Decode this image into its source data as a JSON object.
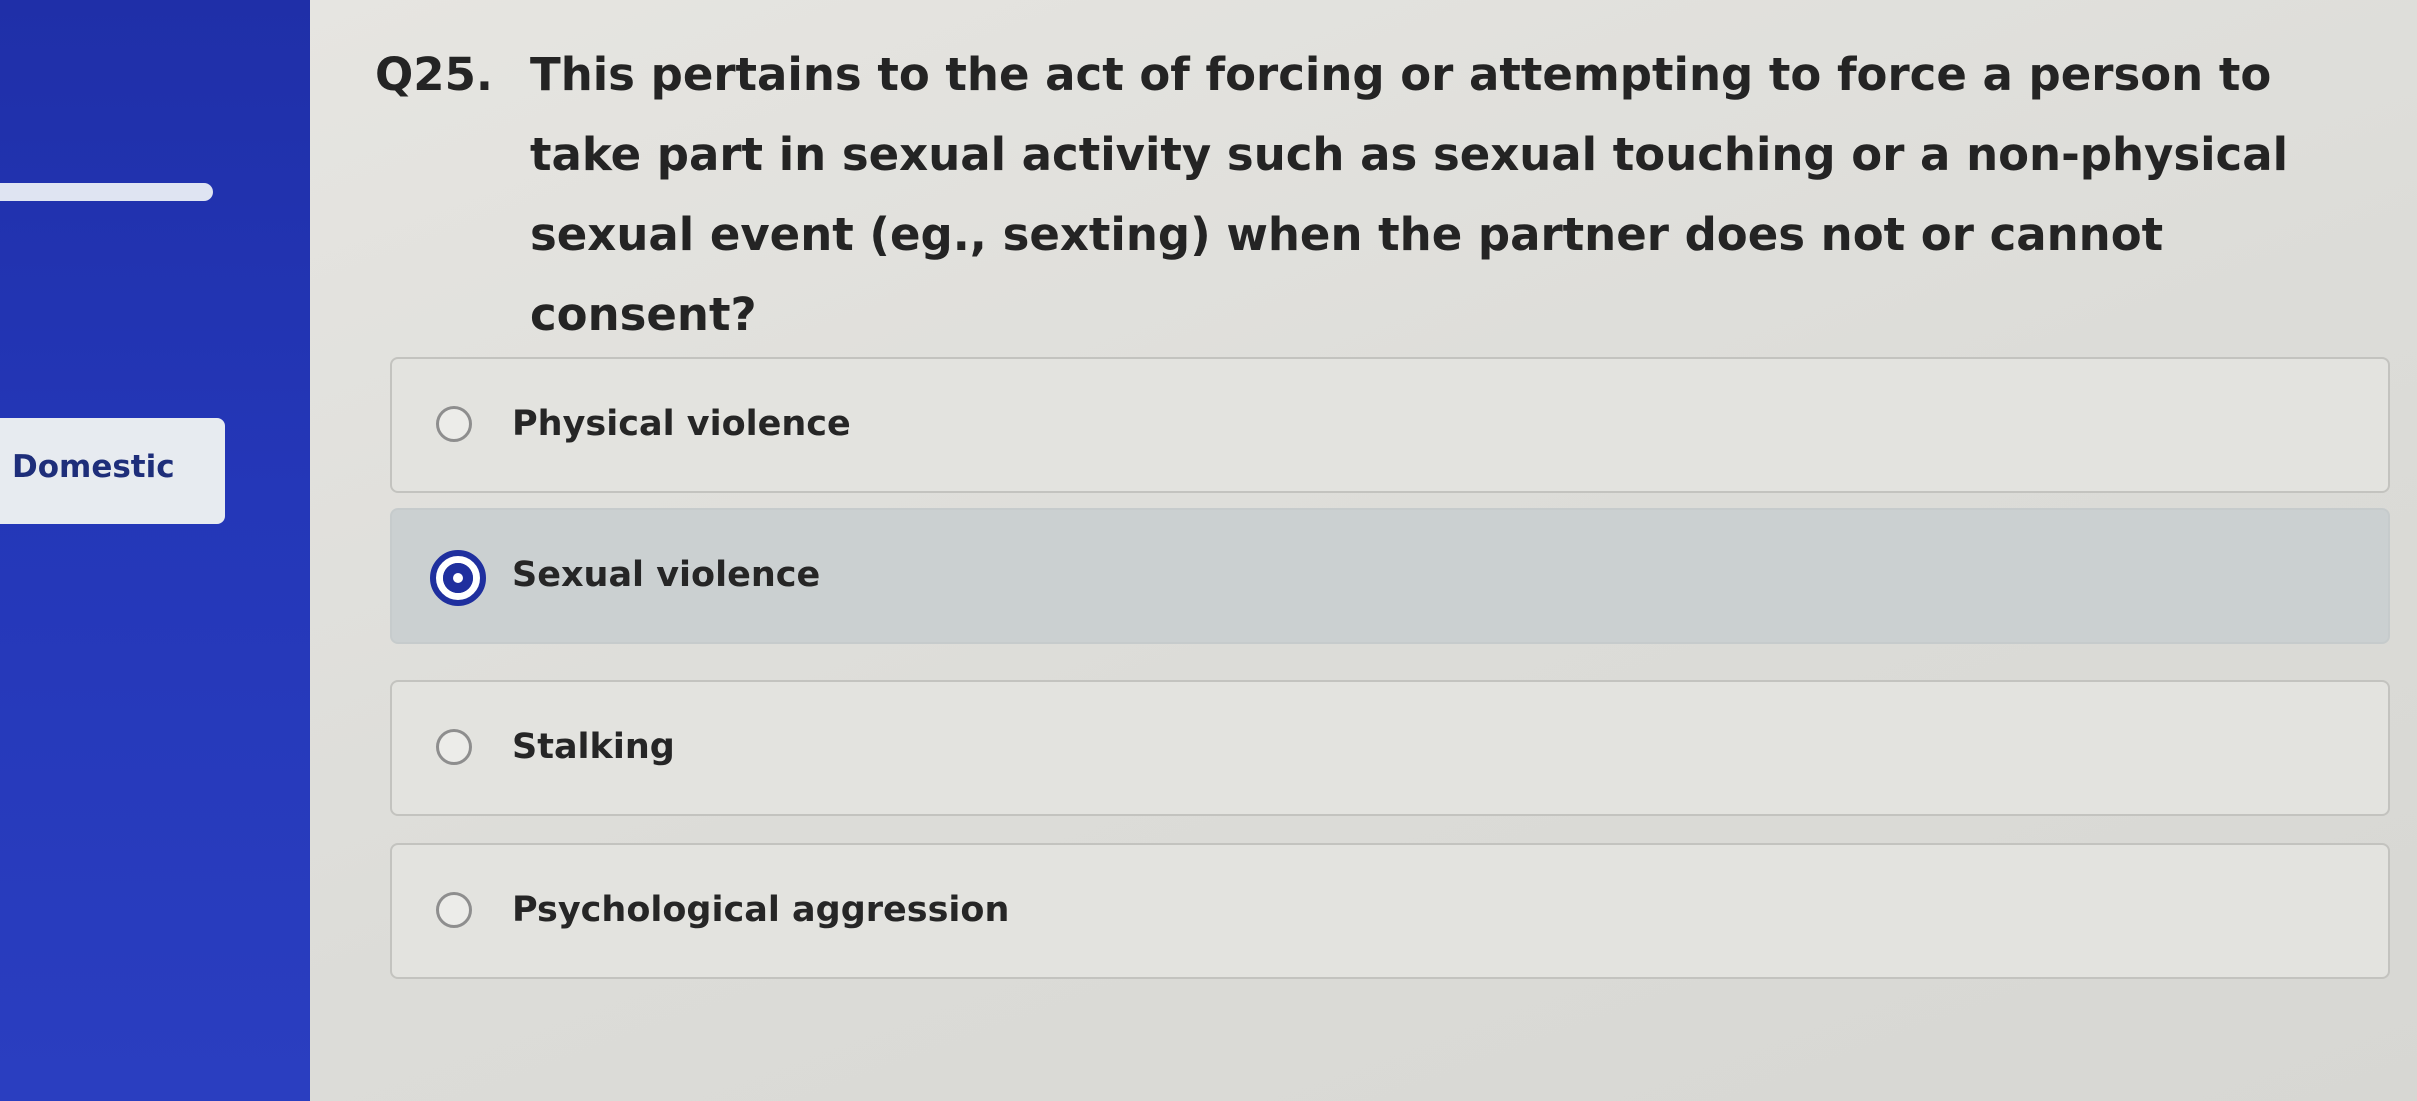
{
  "sidebar": {
    "tab_label": "Domestic"
  },
  "question": {
    "number": "Q25.",
    "text": "This pertains to the act of forcing or attempting to force a person to take part in sexual activity such as sexual touching or a non-physical sexual event (eg., sexting) when the partner does not or cannot consent?"
  },
  "options": [
    {
      "label": "Physical violence",
      "selected": false
    },
    {
      "label": "Sexual violence",
      "selected": true
    },
    {
      "label": "Stalking",
      "selected": false
    },
    {
      "label": "Psychological aggression",
      "selected": false
    }
  ],
  "colors": {
    "sidebar": "#2437b8",
    "accent": "#1f2f9e",
    "selected_option_bg": "#cbd0d1"
  }
}
